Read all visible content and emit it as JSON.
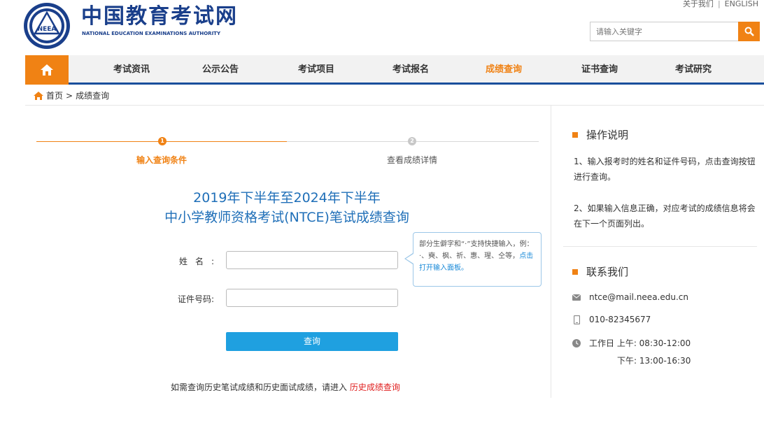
{
  "top_links": {
    "about": "关于我们",
    "english": "ENGLISH"
  },
  "brand": {
    "cn": "中国教育考试网",
    "en": "NATIONAL EDUCATION EXAMINATIONS AUTHORITY",
    "logo_text": "NEEA"
  },
  "search": {
    "placeholder": "请输入关键字"
  },
  "nav": {
    "items": [
      {
        "label": "考试资讯"
      },
      {
        "label": "公示公告"
      },
      {
        "label": "考试项目"
      },
      {
        "label": "考试报名"
      },
      {
        "label": "成绩查询",
        "active": true
      },
      {
        "label": "证书查询"
      },
      {
        "label": "考试研究"
      }
    ]
  },
  "breadcrumb": {
    "home": "首页",
    "separator": ">",
    "current": "成绩查询"
  },
  "steps": [
    {
      "num": "1",
      "label": "输入查询条件",
      "active": true
    },
    {
      "num": "2",
      "label": "查看成绩详情",
      "active": false
    }
  ],
  "title": {
    "line1": "2019年下半年至2024年下半年",
    "line2": "中小学教师资格考试(NTCE)笔试成绩查询"
  },
  "form": {
    "name_label": "姓名:",
    "id_label": "证件号码:",
    "name_value": "",
    "id_value": "",
    "submit": "查询"
  },
  "tip": {
    "text": "部分生僻字和“·”支持快捷输入，例：·、奭、枫、祈、惠、瑆、仝等，",
    "link": "点击打开输入面板。"
  },
  "history": {
    "text": "如需查询历史笔试成绩和历史面试成绩，请进入",
    "link": "历史成绩查询"
  },
  "side": {
    "op_title": "操作说明",
    "op_1": "1、输入报考时的姓名和证件号码，点击查询按钮进行查询。",
    "op_2": "2、如果输入信息正确，对应考试的成绩信息将会在下一个页面列出。",
    "contact_title": "联系我们",
    "email": "ntce@mail.neea.edu.cn",
    "phone": "010-82345677",
    "hours_am": "工作日 上午: 08:30-12:00",
    "hours_pm": "下午: 13:00-16:30"
  },
  "colors": {
    "accent": "#f08214",
    "brand_blue": "#1a3f8b",
    "title_blue": "#1f6fb8",
    "button": "#1fa0e0",
    "link_red": "#e02020"
  }
}
